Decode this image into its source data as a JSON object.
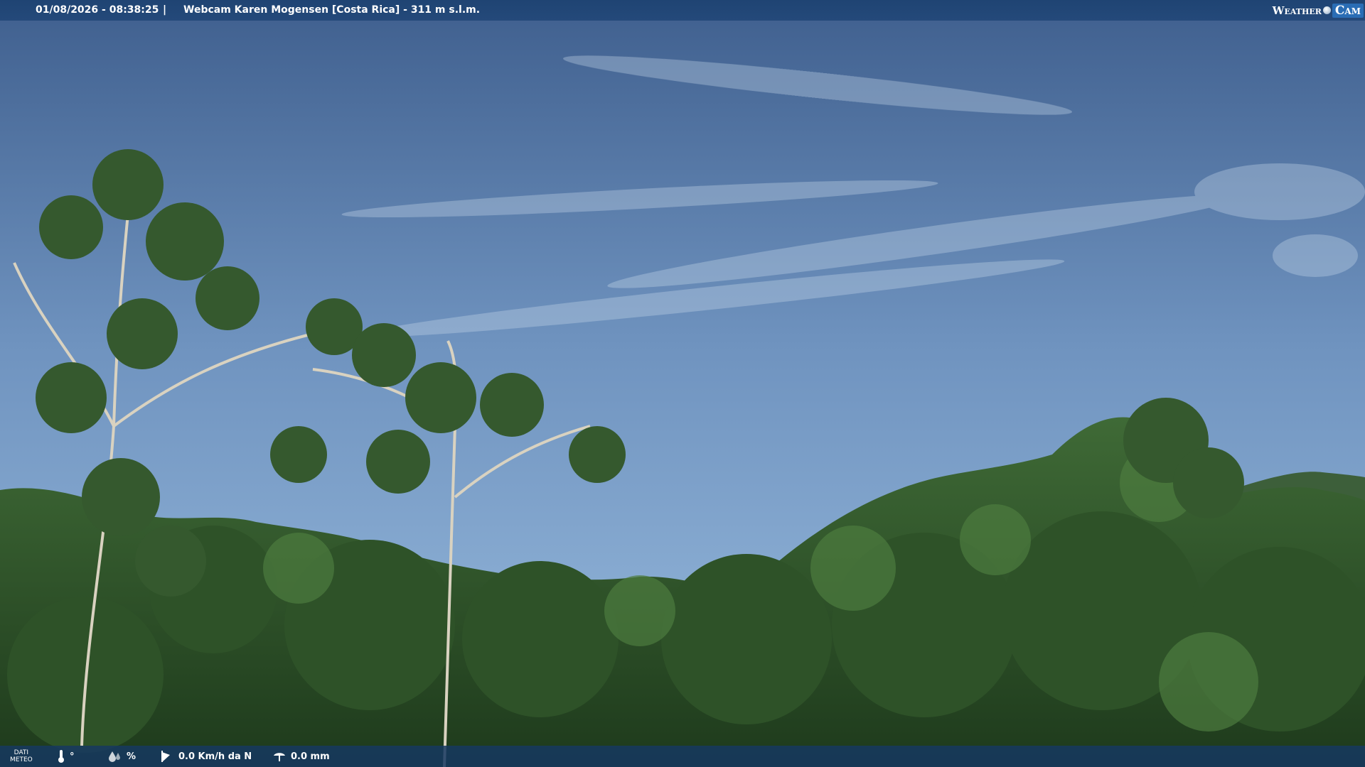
{
  "header": {
    "timestamp": "01/08/2026 - 08:38:25",
    "separator": "|",
    "title": "Webcam Karen Mogensen [Costa Rica]  - 311 m s.l.m."
  },
  "logo": {
    "part1": "Weather",
    "part2": "Cam"
  },
  "footer": {
    "dati_meteo_line1": "DATI",
    "dati_meteo_line2": "METEO",
    "temperature": "°",
    "humidity": "%",
    "wind": "0.0 Km/h da N",
    "rain": "0.0 mm"
  },
  "colors": {
    "sky_top": "#4a6b99",
    "sky_bottom": "#8aaccf",
    "foliage": "#2c4a25",
    "bar": "#1f4473"
  },
  "icons": [
    "thermometer-icon",
    "humidity-icon",
    "wind-icon",
    "rain-icon"
  ]
}
